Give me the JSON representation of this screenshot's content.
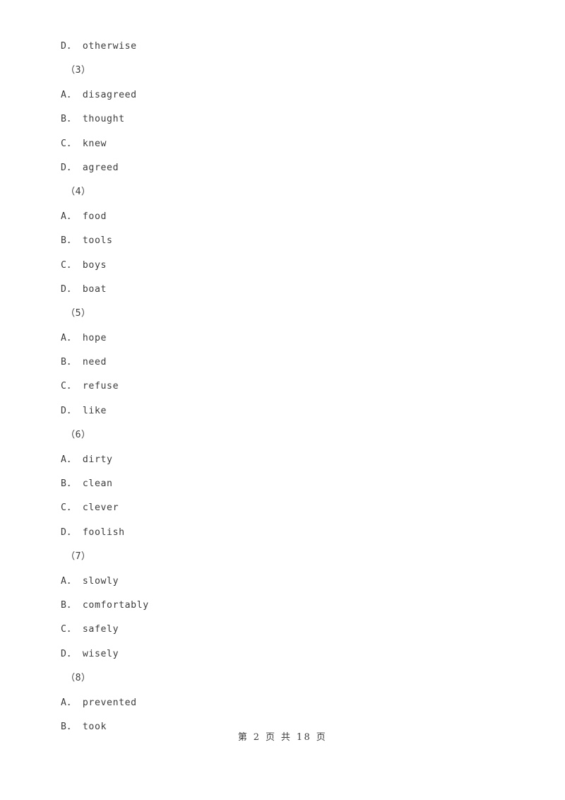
{
  "document": {
    "page_background": "#ffffff",
    "text_color": "#3c3c3c",
    "lines": [
      {
        "kind": "option",
        "text": "D． otherwise"
      },
      {
        "kind": "qnum",
        "text": "（3）"
      },
      {
        "kind": "option",
        "text": "A． disagreed"
      },
      {
        "kind": "option",
        "text": "B． thought"
      },
      {
        "kind": "option",
        "text": "C． knew"
      },
      {
        "kind": "option",
        "text": "D． agreed"
      },
      {
        "kind": "qnum",
        "text": "（4）"
      },
      {
        "kind": "option",
        "text": "A． food"
      },
      {
        "kind": "option",
        "text": "B． tools"
      },
      {
        "kind": "option",
        "text": "C． boys"
      },
      {
        "kind": "option",
        "text": "D． boat"
      },
      {
        "kind": "qnum",
        "text": "（5）"
      },
      {
        "kind": "option",
        "text": "A． hope"
      },
      {
        "kind": "option",
        "text": "B． need"
      },
      {
        "kind": "option",
        "text": "C． refuse"
      },
      {
        "kind": "option",
        "text": "D． like"
      },
      {
        "kind": "qnum",
        "text": "（6）"
      },
      {
        "kind": "option",
        "text": "A． dirty"
      },
      {
        "kind": "option",
        "text": "B． clean"
      },
      {
        "kind": "option",
        "text": "C． clever"
      },
      {
        "kind": "option",
        "text": "D． foolish"
      },
      {
        "kind": "qnum",
        "text": "（7）"
      },
      {
        "kind": "option",
        "text": "A． slowly"
      },
      {
        "kind": "option",
        "text": "B． comfortably"
      },
      {
        "kind": "option",
        "text": "C． safely"
      },
      {
        "kind": "option",
        "text": "D． wisely"
      },
      {
        "kind": "qnum",
        "text": "（8）"
      },
      {
        "kind": "option",
        "text": "A． prevented"
      },
      {
        "kind": "option",
        "text": "B． took"
      }
    ],
    "footer": {
      "text": "第 2 页 共 18 页",
      "current_page": "2",
      "total_pages": "18"
    }
  }
}
